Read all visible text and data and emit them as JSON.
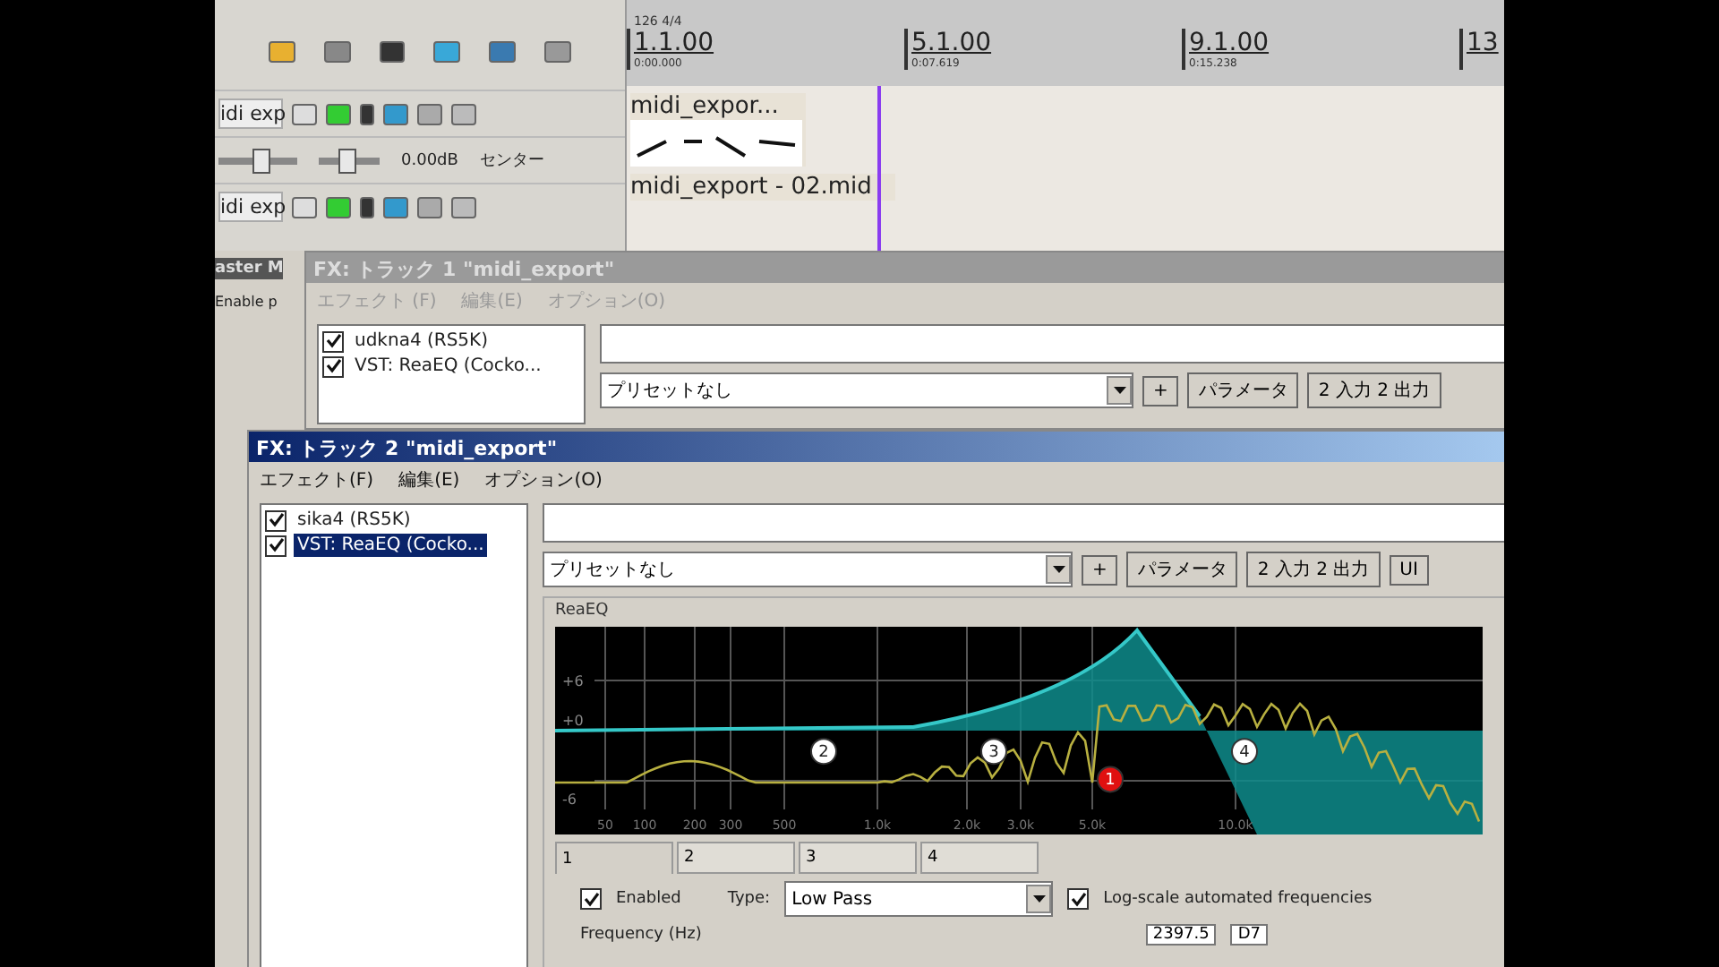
{
  "daw": {
    "tracks": [
      {
        "name": "idi exp",
        "volume_slider": {
          "level": 0.55
        },
        "pan_slider": {
          "level": 0.45
        },
        "volume": "0.00dB",
        "pan": "センター",
        "clip": "midi_expor..."
      },
      {
        "name": "idi exp",
        "clip": "midi_export - 02.mid"
      }
    ],
    "ruler": {
      "tempo": "126 4/4",
      "markers": [
        {
          "bar": "1.1.00",
          "time": "0:00.000"
        },
        {
          "bar": "5.1.00",
          "time": "0:07.619"
        },
        {
          "bar": "9.1.00",
          "time": "0:15.238"
        },
        {
          "bar": "13"
        }
      ]
    },
    "master_label": "aster M",
    "enable_label": "Enable p"
  },
  "fx_windows": [
    {
      "title": "FX: トラック 1 \"midi_export\"",
      "active": false,
      "menu": [
        "エフェクト (F)",
        "編集(E)",
        "オプション(O)"
      ],
      "plugins": [
        {
          "name": "udkna4 (RS5K)",
          "enabled": true,
          "selected": false
        },
        {
          "name": "VST: ReaEQ (Cocko...",
          "enabled": true,
          "selected": false
        }
      ],
      "preset": "プリセットなし",
      "buttons": [
        "+",
        "パラメータ",
        "2 入力 2 出力"
      ]
    },
    {
      "title": "FX: トラック 2 \"midi_export\"",
      "active": true,
      "menu": [
        "エフェクト(F)",
        "編集(E)",
        "オプション(O)"
      ],
      "plugins": [
        {
          "name": "sika4 (RS5K)",
          "enabled": true,
          "selected": false
        },
        {
          "name": "VST: ReaEQ (Cocko...",
          "enabled": true,
          "selected": true
        }
      ],
      "preset": "プリセットなし",
      "buttons": [
        "+",
        "パラメータ",
        "2 入力 2 出力",
        "UI"
      ],
      "eq": {
        "group_label": "ReaEQ",
        "gain_labels": [
          "+6",
          "+0",
          "-6"
        ],
        "freq_labels": [
          "50",
          "100",
          "200",
          "300",
          "500",
          "1.0k",
          "2.0k",
          "3.0k",
          "5.0k",
          "10.0k"
        ],
        "bands": [
          {
            "label": "1",
            "selected": true
          },
          {
            "label": "2",
            "selected": false
          },
          {
            "label": "3",
            "selected": false
          },
          {
            "label": "4",
            "selected": false
          }
        ],
        "tabs": [
          {
            "label": "1",
            "selected": true
          },
          {
            "label": "2",
            "selected": false
          },
          {
            "label": "3",
            "selected": false
          },
          {
            "label": "4",
            "selected": false
          }
        ],
        "enabled": {
          "label": "Enabled",
          "checked": true
        },
        "type_label": "Type:",
        "type_value": "Low Pass",
        "log_scale": {
          "label": "Log-scale automated frequencies",
          "checked": true
        },
        "frequency_label": "Frequency (Hz)",
        "frequency_value": "2397.5",
        "note": "D7"
      }
    }
  ]
}
